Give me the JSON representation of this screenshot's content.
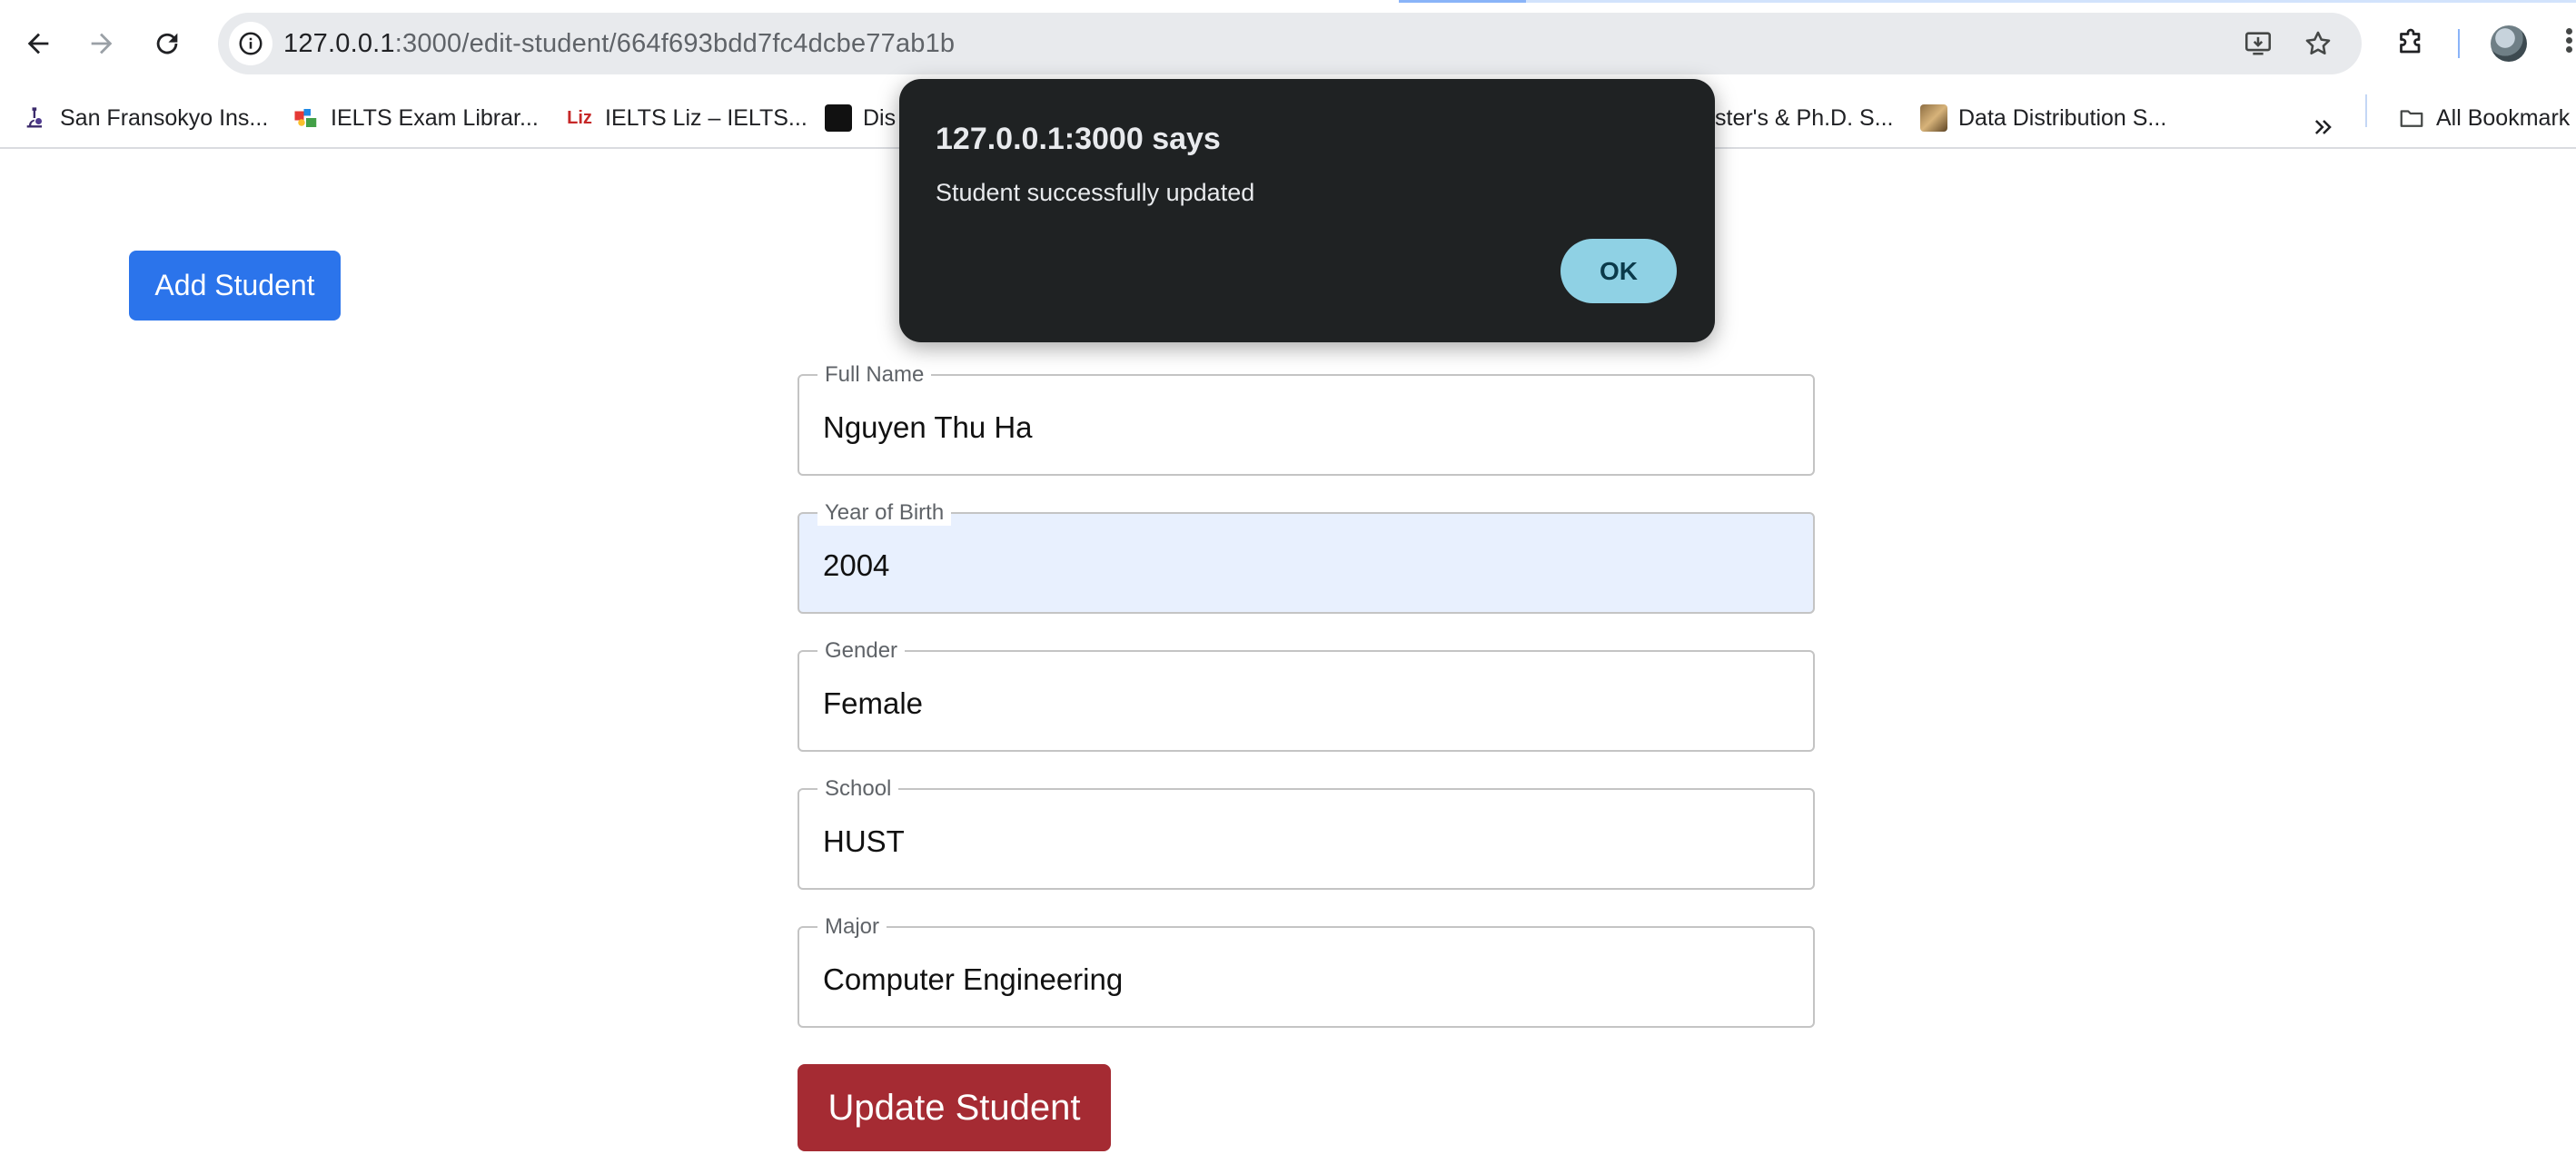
{
  "browser": {
    "url_host": "127.0.0.1",
    "url_path": ":3000/edit-student/664f693bdd7fc4dcbe77ab1b"
  },
  "bookmarks": [
    {
      "label": "San Fransokyo Ins...",
      "icon": "microscope-icon"
    },
    {
      "label": "IELTS Exam Librar...",
      "icon": "ielts-library-icon"
    },
    {
      "label": "IELTS Liz – IELTS...",
      "icon": "liz-icon",
      "icon_text": "Liz"
    },
    {
      "label": "Dis",
      "icon": "black-square-icon"
    },
    {
      "label": "ster's & Ph.D. S...",
      "icon": ""
    },
    {
      "label": "Data Distribution S...",
      "icon": "book-cover-icon"
    }
  ],
  "bookmarks_all_label": "All Bookmark",
  "page": {
    "add_button": "Add Student",
    "fields": [
      {
        "label": "Full Name",
        "value": "Nguyen Thu Ha"
      },
      {
        "label": "Year of Birth",
        "value": "2004"
      },
      {
        "label": "Gender",
        "value": "Female"
      },
      {
        "label": "School",
        "value": "HUST"
      },
      {
        "label": "Major",
        "value": "Computer Engineering"
      }
    ],
    "update_button": "Update Student"
  },
  "dialog": {
    "title": "127.0.0.1:3000 says",
    "message": "Student successfully updated",
    "ok_label": "OK"
  },
  "colors": {
    "add_button": "#2b74eb",
    "update_button": "#a52b33",
    "dialog_bg": "#1f2223",
    "ok_button": "#8fd1e4",
    "autofill_bg": "#e8f0fe"
  }
}
